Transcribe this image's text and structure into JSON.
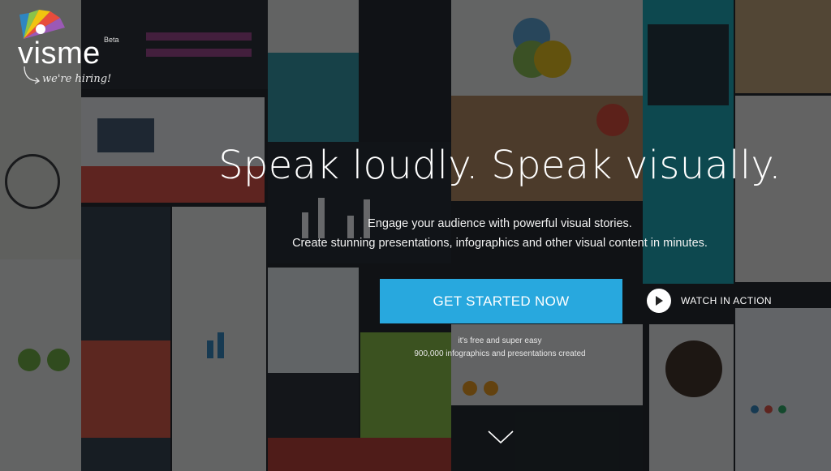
{
  "brand": {
    "name": "visme",
    "beta_label": "Beta",
    "hiring_text": "we're hiring!"
  },
  "hero": {
    "headline": "Speak loudly. Speak visually.",
    "subline_1": "Engage your audience with powerful visual stories.",
    "subline_2": "Create stunning presentations, infographics and other visual content in minutes.",
    "cta_label": "GET STARTED NOW",
    "watch_label": "WATCH IN ACTION",
    "note_1": "it's free and super easy",
    "note_2": "900,000 infographics and presentations created"
  },
  "icons": {
    "play": "play-icon",
    "scroll": "chevron-down-icon"
  },
  "colors": {
    "accent": "#28a8de",
    "overlay": "#0a0c0e"
  }
}
